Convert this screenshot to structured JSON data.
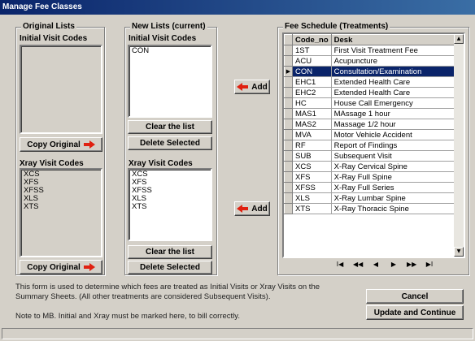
{
  "window": {
    "title": "Manage Fee Classes"
  },
  "original": {
    "group_title": "Original Lists",
    "initial_label": "Initial Visit Codes",
    "initial_items": [],
    "copy_initial_label": "Copy Original",
    "xray_label": "Xray Visit Codes",
    "xray_items": [
      "XCS",
      "XFS",
      "XFSS",
      "XLS",
      "XTS"
    ],
    "copy_xray_label": "Copy Original"
  },
  "current": {
    "group_title": "New Lists (current)",
    "initial_label": "Initial Visit Codes",
    "initial_items": [
      "CON"
    ],
    "clear_initial_label": "Clear the list",
    "delete_initial_label": "Delete Selected",
    "xray_label": "Xray Visit Codes",
    "xray_items": [
      "XCS",
      "XFS",
      "XFSS",
      "XLS",
      "XTS"
    ],
    "clear_xray_label": "Clear the list",
    "delete_xray_label": "Delete Selected"
  },
  "add_buttons": {
    "initial_label": "Add",
    "xray_label": "Add"
  },
  "schedule": {
    "group_title": "Fee Schedule (Treatments)",
    "columns": [
      "Code_no",
      "Desk"
    ],
    "selected_code": "CON",
    "rows": [
      {
        "code": "1ST",
        "desk": "First Visit Treatment Fee"
      },
      {
        "code": "ACU",
        "desk": "Acupuncture"
      },
      {
        "code": "CON",
        "desk": "Consultation/Examination"
      },
      {
        "code": "EHC1",
        "desk": "Extended Health Care"
      },
      {
        "code": "EHC2",
        "desk": "Extended Health Care"
      },
      {
        "code": "HC",
        "desk": "House Call Emergency"
      },
      {
        "code": "MAS1",
        "desk": "MAssage 1 hour"
      },
      {
        "code": "MAS2",
        "desk": "Massage 1/2 hour"
      },
      {
        "code": "MVA",
        "desk": "Motor Vehicle Accident"
      },
      {
        "code": "RF",
        "desk": "Report of Findings"
      },
      {
        "code": "SUB",
        "desk": "Subsequent Visit"
      },
      {
        "code": "XCS",
        "desk": "X-Ray Cervical Spine"
      },
      {
        "code": "XFS",
        "desk": "X-Ray Full Spine"
      },
      {
        "code": "XFSS",
        "desk": "X-Ray Full Series"
      },
      {
        "code": "XLS",
        "desk": "X-Ray Lumbar Spine"
      },
      {
        "code": "XTS",
        "desk": "X-Ray Thoracic Spine"
      }
    ]
  },
  "notes": {
    "line1": "This form is used to determine which fees are treated as Initial Visits or Xray Visits on the",
    "line2": "Summary Sheets. (All other treatments are considered Subsequent Visits).",
    "line3": "Note to MB. Initial and Xray must be marked here, to bill correctly."
  },
  "actions": {
    "cancel_label": "Cancel",
    "update_label": "Update and Continue"
  }
}
